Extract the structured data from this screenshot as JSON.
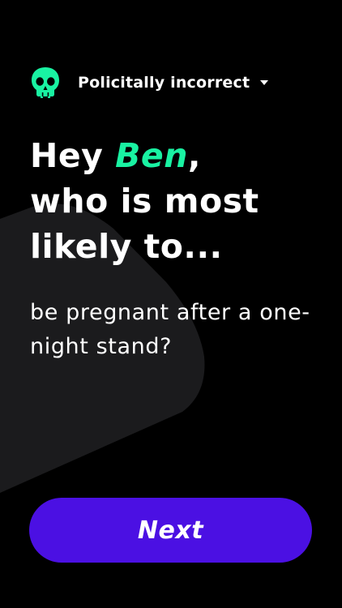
{
  "header": {
    "category_label": "Policitally incorrect",
    "category_icon": "skull-icon",
    "dropdown_icon": "caret-down-icon"
  },
  "headline": {
    "greeting": "Hey",
    "player_name": "Ben",
    "comma": ",",
    "line2": "who is most",
    "line3": "likely to..."
  },
  "question": {
    "text": "be pregnant after a one-night stand?"
  },
  "next_button": {
    "label": "Next"
  },
  "colors": {
    "background": "#000000",
    "accent_green": "#19f2a2",
    "button_purple": "#4b10e3",
    "shape_gray": "#1b1b1d"
  }
}
